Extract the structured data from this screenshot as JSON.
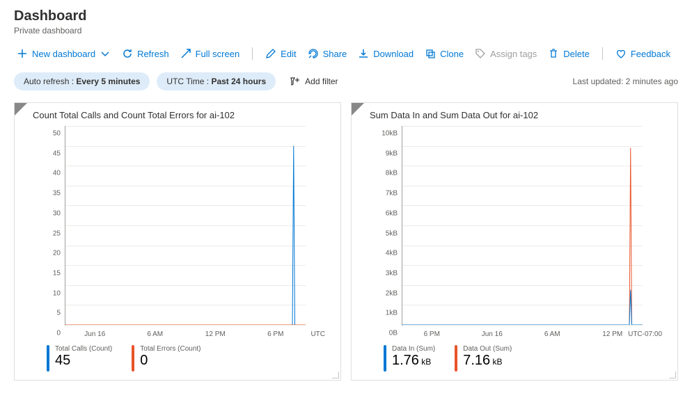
{
  "header": {
    "title": "Dashboard",
    "subtitle": "Private dashboard"
  },
  "toolbar": {
    "new_dashboard": "New dashboard",
    "refresh": "Refresh",
    "full_screen": "Full screen",
    "edit": "Edit",
    "share": "Share",
    "download": "Download",
    "clone": "Clone",
    "assign_tags": "Assign tags",
    "delete": "Delete",
    "feedback": "Feedback"
  },
  "filters": {
    "auto_refresh_label": "Auto refresh : ",
    "auto_refresh_value": "Every 5 minutes",
    "utc_label": "UTC Time : ",
    "utc_value": "Past 24 hours",
    "add_filter": "Add filter",
    "last_updated": "Last updated: 2 minutes ago"
  },
  "tiles": [
    {
      "title": "Count Total Calls and Count Total Errors for ai-102",
      "legend": [
        {
          "label": "Total Calls (Count)",
          "value": "45",
          "unit": "",
          "color": "#0078d4"
        },
        {
          "label": "Total Errors (Count)",
          "value": "0",
          "unit": "",
          "color": "#e8542a"
        }
      ],
      "x_unit": "UTC"
    },
    {
      "title": "Sum Data In and Sum Data Out for ai-102",
      "legend": [
        {
          "label": "Data In (Sum)",
          "value": "1.76",
          "unit": "kB",
          "color": "#0078d4"
        },
        {
          "label": "Data Out (Sum)",
          "value": "7.16",
          "unit": "kB",
          "color": "#e8542a"
        }
      ],
      "x_unit": "UTC-07:00"
    }
  ],
  "chart_data": [
    {
      "type": "line",
      "title": "Count Total Calls and Count Total Errors for ai-102",
      "xlabel": "",
      "ylabel": "",
      "ylim": [
        0,
        50
      ],
      "yticks": [
        0,
        5,
        10,
        15,
        20,
        25,
        30,
        35,
        40,
        45,
        50
      ],
      "x_categories": [
        "Jun 16",
        "6 AM",
        "12 PM",
        "6 PM"
      ],
      "x_positions": [
        0.125,
        0.375,
        0.625,
        0.875
      ],
      "series": [
        {
          "name": "Total Calls (Count)",
          "color": "#0078d4",
          "points": [
            [
              0,
              0
            ],
            [
              0.945,
              0
            ],
            [
              0.95,
              45
            ],
            [
              0.955,
              0
            ],
            [
              1,
              0
            ]
          ]
        },
        {
          "name": "Total Errors (Count)",
          "color": "#e8542a",
          "points": [
            [
              0,
              0
            ],
            [
              1,
              0
            ]
          ]
        }
      ]
    },
    {
      "type": "line",
      "title": "Sum Data In and Sum Data Out for ai-102",
      "xlabel": "",
      "ylabel": "",
      "ylim": [
        0,
        10000
      ],
      "yticks_labels": [
        "0B",
        "1kB",
        "2kB",
        "3kB",
        "4kB",
        "5kB",
        "6kB",
        "7kB",
        "8kB",
        "9kB",
        "10kB"
      ],
      "x_categories": [
        "6 PM",
        "Jun 16",
        "6 AM",
        "12 PM"
      ],
      "x_positions": [
        0.125,
        0.375,
        0.625,
        0.875
      ],
      "series": [
        {
          "name": "Data Out (Sum)",
          "color": "#e8542a",
          "points": [
            [
              0,
              0
            ],
            [
              0.945,
              0
            ],
            [
              0.95,
              8900
            ],
            [
              0.955,
              0
            ],
            [
              1,
              0
            ]
          ]
        },
        {
          "name": "Data In (Sum)",
          "color": "#0078d4",
          "points": [
            [
              0,
              0
            ],
            [
              0.945,
              0
            ],
            [
              0.95,
              1760
            ],
            [
              0.955,
              0
            ],
            [
              1,
              0
            ]
          ]
        }
      ]
    }
  ]
}
